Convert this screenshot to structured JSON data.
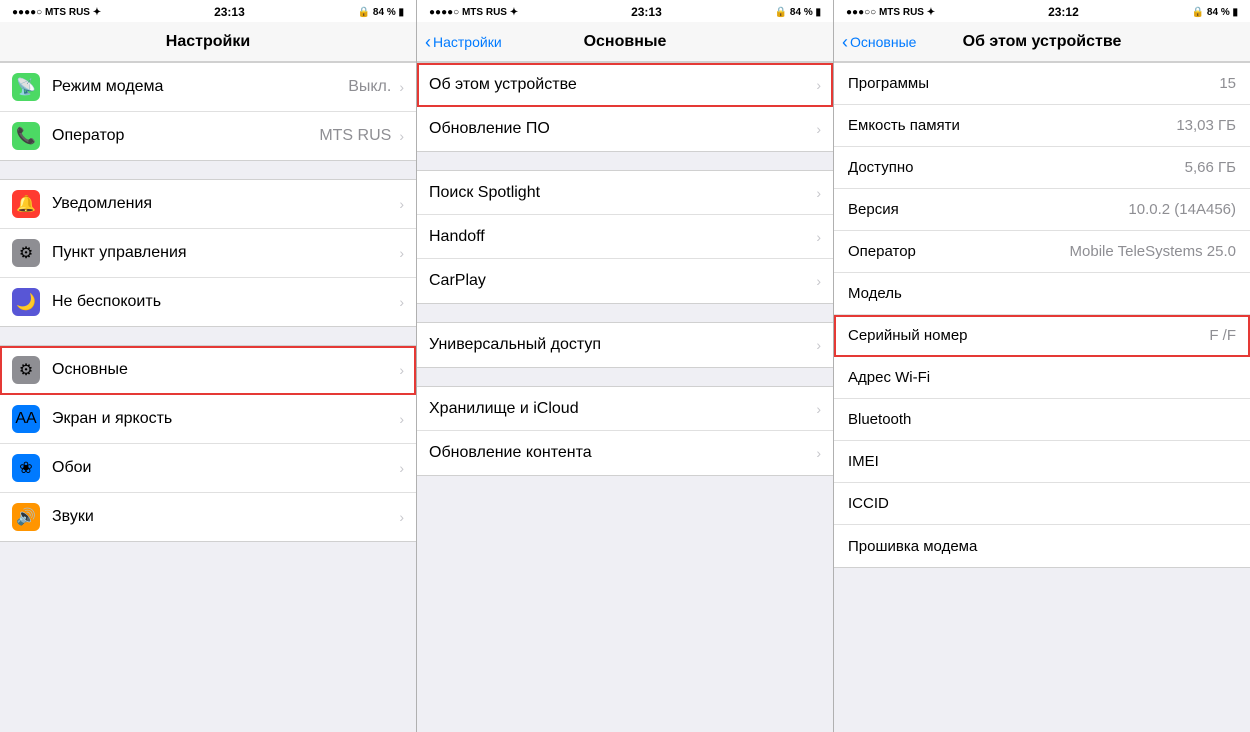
{
  "phones": [
    {
      "id": "phone1",
      "statusBar": {
        "left": "●●●●○ MTS RUS ✦",
        "center": "23:13",
        "right": "🔒 84 % ▮"
      },
      "navTitle": "Настройки",
      "navBack": null,
      "items": [
        {
          "icon": "📡",
          "iconBg": "icon-green",
          "label": "Режим модема",
          "value": "Выкл.",
          "chevron": true,
          "highlighted": false
        },
        {
          "icon": "📞",
          "iconBg": "icon-green",
          "label": "Оператор",
          "value": "MTS RUS",
          "chevron": true,
          "highlighted": false
        },
        {
          "separator": true
        },
        {
          "icon": "🔔",
          "iconBg": "icon-red",
          "label": "Уведомления",
          "value": "",
          "chevron": true,
          "highlighted": false
        },
        {
          "icon": "⚙",
          "iconBg": "icon-gray",
          "label": "Пункт управления",
          "value": "",
          "chevron": true,
          "highlighted": false
        },
        {
          "icon": "🌙",
          "iconBg": "icon-purple",
          "label": "Не беспокоить",
          "value": "",
          "chevron": true,
          "highlighted": false
        },
        {
          "separator": true
        },
        {
          "icon": "⚙",
          "iconBg": "icon-gray",
          "label": "Основные",
          "value": "",
          "chevron": true,
          "highlighted": true
        },
        {
          "icon": "AA",
          "iconBg": "icon-blue",
          "label": "Экран и яркость",
          "value": "",
          "chevron": true,
          "highlighted": false
        },
        {
          "icon": "❀",
          "iconBg": "icon-blue",
          "label": "Обои",
          "value": "",
          "chevron": true,
          "highlighted": false
        },
        {
          "icon": "🔊",
          "iconBg": "icon-orange",
          "label": "Звуки",
          "value": "",
          "chevron": true,
          "highlighted": false
        }
      ]
    },
    {
      "id": "phone2",
      "statusBar": {
        "left": "●●●●○ MTS RUS ✦",
        "center": "23:13",
        "right": "🔒 84 % ▮"
      },
      "navBack": "Настройки",
      "navTitle": "Основные",
      "items": [
        {
          "label": "Об этом устройстве",
          "value": "",
          "chevron": true,
          "highlighted": true
        },
        {
          "label": "Обновление ПО",
          "value": "",
          "chevron": true,
          "highlighted": false
        },
        {
          "separator": true
        },
        {
          "label": "Поиск Spotlight",
          "value": "",
          "chevron": true,
          "highlighted": false
        },
        {
          "label": "Handoff",
          "value": "",
          "chevron": true,
          "highlighted": false
        },
        {
          "label": "CarPlay",
          "value": "",
          "chevron": true,
          "highlighted": false
        },
        {
          "separator": true
        },
        {
          "label": "Универсальный доступ",
          "value": "",
          "chevron": true,
          "highlighted": false
        },
        {
          "separator": true
        },
        {
          "label": "Хранилище и iCloud",
          "value": "",
          "chevron": true,
          "highlighted": false
        },
        {
          "label": "Обновление контента",
          "value": "",
          "chevron": true,
          "highlighted": false
        }
      ]
    },
    {
      "id": "phone3",
      "statusBar": {
        "left": "●●●○○ MTS RUS ✦",
        "center": "23:12",
        "right": "🔒 84 % ▮"
      },
      "navBack": "Основные",
      "navTitle": "Об этом устройстве",
      "infoRows": [
        {
          "label": "Программы",
          "value": "15"
        },
        {
          "label": "Емкость памяти",
          "value": "13,03 ГБ"
        },
        {
          "label": "Доступно",
          "value": "5,66 ГБ"
        },
        {
          "label": "Версия",
          "value": "10.0.2 (14A456)"
        },
        {
          "label": "Оператор",
          "value": "Mobile TeleSystems 25.0"
        },
        {
          "label": "Модель",
          "value": ""
        },
        {
          "label": "Серийный номер",
          "value": "F                 /F",
          "highlighted": true
        },
        {
          "label": "Адрес Wi-Fi",
          "value": ""
        },
        {
          "label": "Bluetooth",
          "value": ""
        },
        {
          "label": "IMEI",
          "value": ""
        },
        {
          "label": "ICCID",
          "value": ""
        },
        {
          "label": "Прошивка модема",
          "value": ""
        }
      ]
    }
  ]
}
